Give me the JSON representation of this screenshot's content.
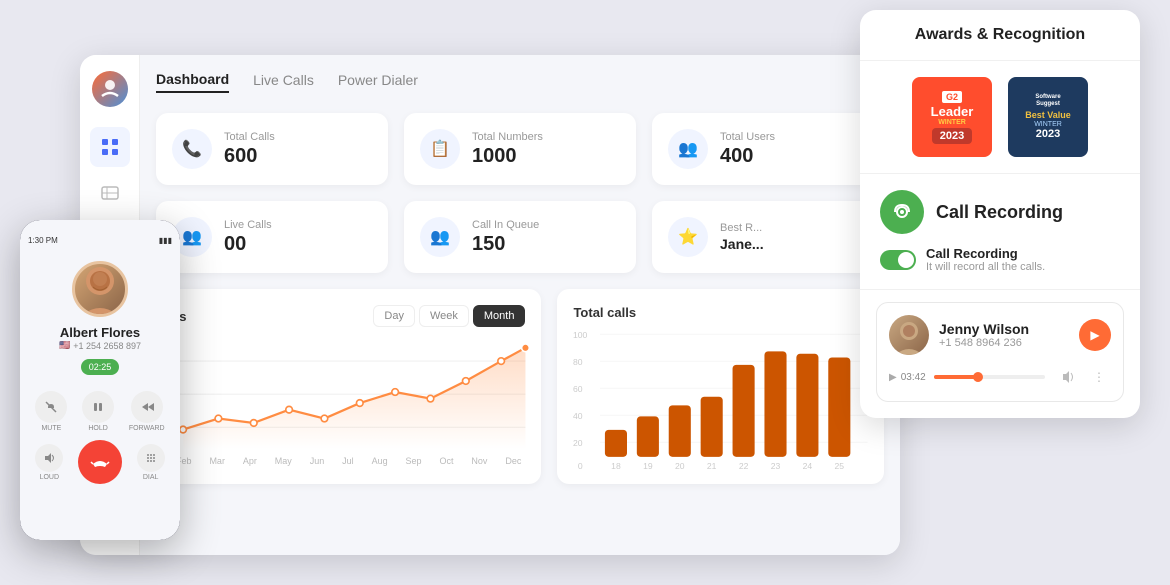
{
  "page": {
    "background_color": "#e2e4ef"
  },
  "nav": {
    "tabs": [
      {
        "label": "Dashboard",
        "active": true
      },
      {
        "label": "Live Calls",
        "active": false
      },
      {
        "label": "Power Dialer",
        "active": false
      }
    ]
  },
  "stats": [
    {
      "icon": "📞",
      "label": "Total Calls",
      "value": "600"
    },
    {
      "icon": "📋",
      "label": "Total Numbers",
      "value": "1000"
    },
    {
      "icon": "👥",
      "label": "Total Users",
      "value": "400"
    }
  ],
  "stats2": [
    {
      "icon": "👥",
      "label": "Live Calls",
      "value": "00"
    },
    {
      "icon": "👥",
      "label": "Call In Queue",
      "value": "150"
    },
    {
      "icon": "⭐",
      "label": "Best R...",
      "value": "Jane..."
    }
  ],
  "chart": {
    "title": "es",
    "toggle_buttons": [
      "Day",
      "Week",
      "Month"
    ],
    "active_toggle": "Month",
    "months": [
      "Feb",
      "Mar",
      "Apr",
      "May",
      "Jun",
      "Jul",
      "Aug",
      "Sep",
      "Oct",
      "Nov",
      "Dec"
    ],
    "line_values": [
      18,
      22,
      20,
      25,
      22,
      27,
      30,
      28,
      34,
      42,
      55
    ]
  },
  "bar_chart": {
    "title": "Total calls",
    "y_labels": [
      "100",
      "80",
      "60",
      "40",
      "20",
      "0"
    ],
    "x_labels": [
      "18",
      "19",
      "20",
      "21",
      "22",
      "23",
      "24",
      "25"
    ],
    "bar_values": [
      20,
      30,
      38,
      45,
      70,
      80,
      78,
      75
    ]
  },
  "phone": {
    "status_time": "1:30 PM",
    "caller_name": "Albert Flores",
    "caller_number": "+1 254 2658 897",
    "call_timer": "02:25",
    "controls": [
      {
        "icon": "🔇",
        "label": "MUTE"
      },
      {
        "icon": "⏸",
        "label": "HOLD"
      },
      {
        "icon": "➡",
        "label": "FORWARD"
      }
    ],
    "bottom_controls": [
      {
        "icon": "🔊",
        "label": "LOUD"
      },
      {
        "icon": "📞",
        "label": "",
        "type": "hangup"
      },
      {
        "icon": "⌨",
        "label": "DIAL"
      }
    ]
  },
  "awards": {
    "title": "Awards & Recognition",
    "badges": [
      {
        "type": "g2",
        "lines": [
          "G2",
          "Leader",
          "WINTER",
          "2023"
        ],
        "bg": "#ff4d2d"
      },
      {
        "type": "software_suggest",
        "lines": [
          "Software",
          "Suggest",
          "Best Value",
          "WINTER",
          "2023"
        ],
        "bg": "#1e3a5f"
      }
    ]
  },
  "call_recording": {
    "title": "Call Recording",
    "icon_bg": "#4caf50",
    "toggle_label": "Call Recording",
    "toggle_desc": "It will record all the calls.",
    "toggle_enabled": true
  },
  "jenny": {
    "name": "Jenny Wilson",
    "number": "+1 548 8964 236",
    "time": "03:42",
    "play_icon": "▶"
  }
}
